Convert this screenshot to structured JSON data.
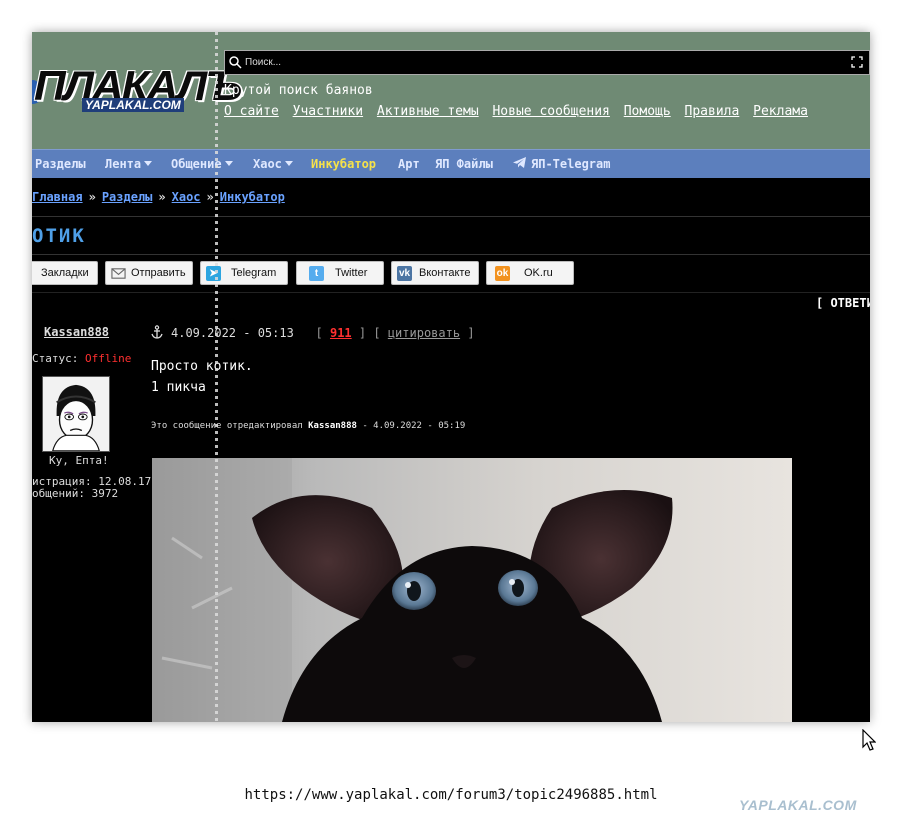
{
  "logo": {
    "main": "ПЛАКАЛЪ",
    "sub": "YAPLAKAL.COM"
  },
  "search": {
    "placeholder": "Поиск..."
  },
  "header": {
    "slogan": "Крутой поиск баянов",
    "links": [
      "О сайте",
      "Участники",
      "Активные темы",
      "Новые сообщения",
      "Помощь",
      "Правила",
      "Реклама"
    ]
  },
  "nav": {
    "items": [
      "Разделы",
      "Лента",
      "Общение",
      "Хаос",
      "Инкубатор",
      "Арт",
      "ЯП Файлы",
      "ЯП-Telegram"
    ]
  },
  "breadcrumb": {
    "items": [
      "Главная",
      "Разделы",
      "Хаос",
      "Инкубатор"
    ],
    "separator": "»"
  },
  "topic": {
    "title": "ОТИК"
  },
  "share": {
    "buttons": [
      "Закладки",
      "Отправить",
      "Telegram",
      "Twitter",
      "Вконтакте",
      "OK.ru"
    ]
  },
  "reply_label": "[ ОТВЕТИ",
  "post": {
    "author": "Kassan888",
    "date": "4.09.2022 - 05:13",
    "number": "911",
    "quote_label": "цитировать",
    "status_label": "Статус:",
    "status_value": "Offline",
    "avatar_caption": "Ку, Епта!",
    "reg_line": "истрация: 12.08.17",
    "msgs_line": "общений: 3972",
    "text_lines": [
      "Просто котик.",
      "1 пикча"
    ],
    "edited_prefix": "Это сообщение отредактировал",
    "edited_by": "Kassan888",
    "edited_date": "- 4.09.2022 - 05:19"
  },
  "footer": {
    "url": "https://www.yaplakal.com/forum3/topic2496885.html",
    "watermark": "YAPLAKAL.COM"
  },
  "colors": {
    "header_bg": "#6f8a74",
    "nav_bg": "#5c7fbd",
    "title": "#4fa0e8",
    "link": "#6aa2ff",
    "offline": "#ff3030",
    "incubator": "#f6e24a"
  }
}
